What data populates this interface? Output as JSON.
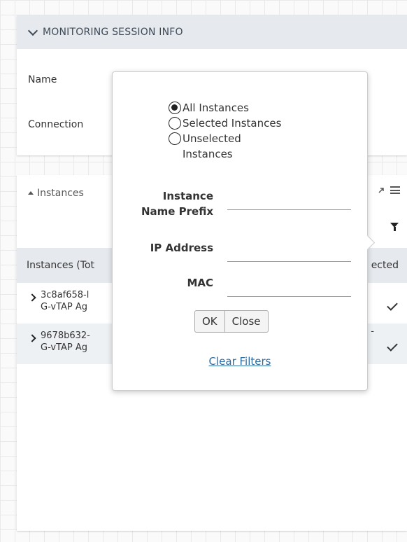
{
  "session_panel": {
    "header": "MONITORING SESSION INFO",
    "name_label": "Name",
    "connection_label": "Connection"
  },
  "instances_panel": {
    "header": "Instances",
    "table_header_left": "Instances (Tot",
    "table_header_right": "ected",
    "rows": [
      {
        "line1": "3c8af658-l",
        "line2": "G-vTAP Ag",
        "selected": true,
        "dash": ""
      },
      {
        "line1": "9678b632-",
        "line2": "G-vTAP Ag",
        "selected": true,
        "dash": "-"
      }
    ]
  },
  "filter_popup": {
    "radio_options": [
      {
        "label": "All Instances",
        "checked": true
      },
      {
        "label": "Selected Instances",
        "checked": false
      },
      {
        "label": "Unselected Instances",
        "checked": false
      }
    ],
    "fields": [
      {
        "label": "Instance Name Prefix",
        "value": ""
      },
      {
        "label": "IP Address",
        "value": ""
      },
      {
        "label": "MAC",
        "value": ""
      }
    ],
    "ok_label": "OK",
    "close_label": "Close",
    "clear_filters_label": "Clear Filters"
  }
}
